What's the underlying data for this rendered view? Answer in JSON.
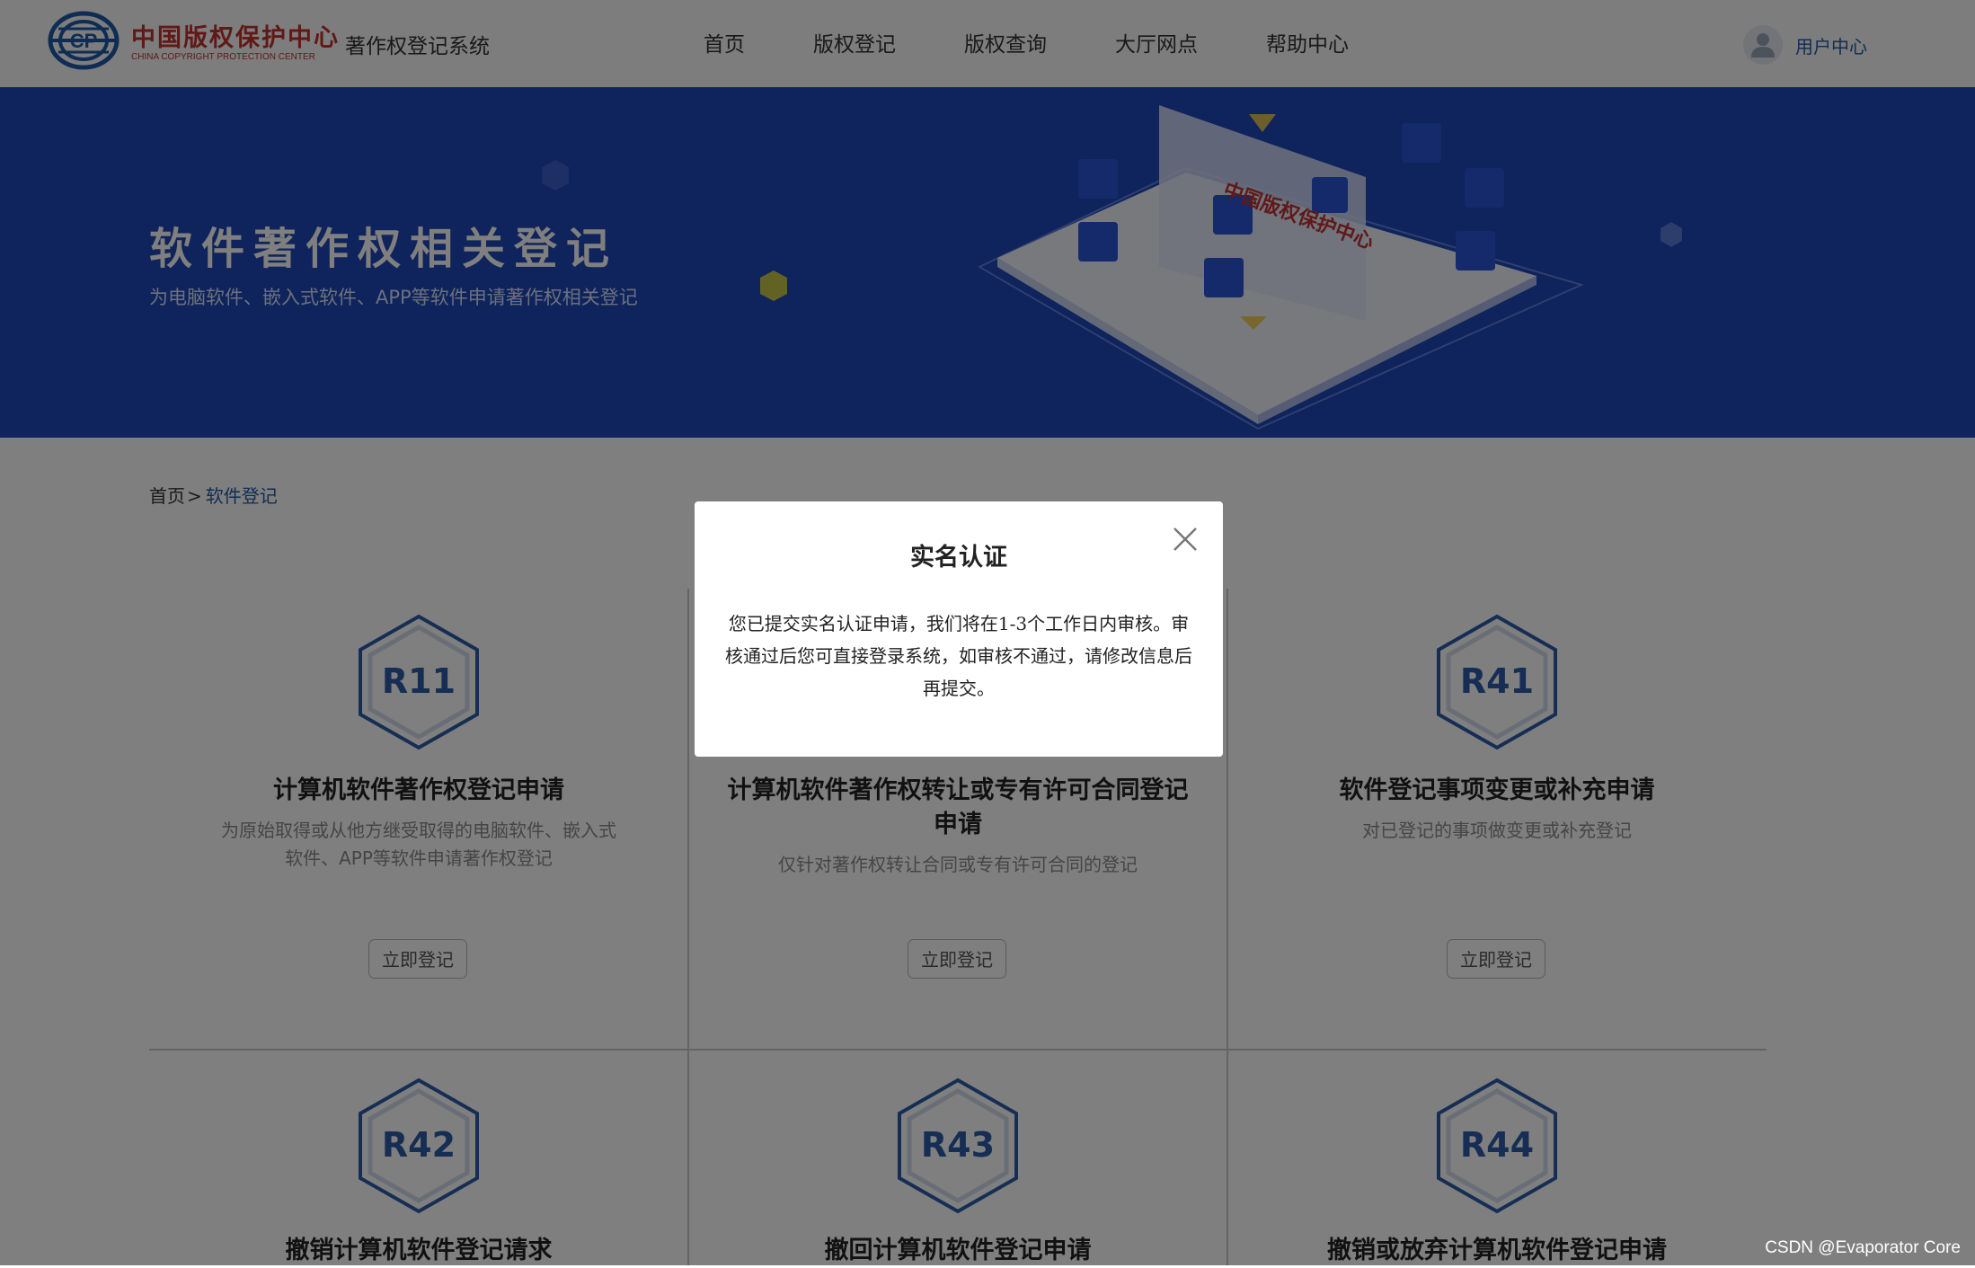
{
  "header": {
    "logo_cn": "中国版权保护中心",
    "logo_en": "CHINA COPYRIGHT PROTECTION CENTER",
    "system_title": "著作权登记系统",
    "nav": [
      "首页",
      "版权登记",
      "版权查询",
      "大厅网点",
      "帮助中心"
    ],
    "user_label": "用户中心"
  },
  "banner": {
    "title": "软件著作权相关登记",
    "subtitle": "为电脑软件、嵌入式软件、APP等软件申请著作权相关登记"
  },
  "breadcrumb": {
    "home": "首页",
    "separator": ">",
    "current": "软件登记"
  },
  "cards": [
    {
      "code": "R11",
      "title": "计算机软件著作权登记申请",
      "desc": "为原始取得或从他方继受取得的电脑软件、嵌入式软件、APP等软件申请著作权登记",
      "button": "立即登记"
    },
    {
      "code": "",
      "title": "计算机软件著作权转让或专有许可合同登记申请",
      "desc": "仅针对著作权转让合同或专有许可合同的登记",
      "button": "立即登记"
    },
    {
      "code": "R41",
      "title": "软件登记事项变更或补充申请",
      "desc": "对已登记的事项做变更或补充登记",
      "button": "立即登记"
    },
    {
      "code": "R42",
      "title": "撤销计算机软件登记请求"
    },
    {
      "code": "R43",
      "title": "撤回计算机软件登记申请"
    },
    {
      "code": "R44",
      "title": "撤销或放弃计算机软件登记申请"
    }
  ],
  "modal": {
    "title": "实名认证",
    "body": "您已提交实名认证申请，我们将在1-3个工作日内审核。审核通过后您可直接登录系统，如审核不通过，请修改信息后再提交。"
  },
  "watermark": "CSDN @Evaporator Core",
  "colors": {
    "brand_red": "#c0322e",
    "banner_blue": "#1e46b9",
    "accent_blue": "#1e5aa8",
    "hex_blue": "#2c5aa8"
  }
}
